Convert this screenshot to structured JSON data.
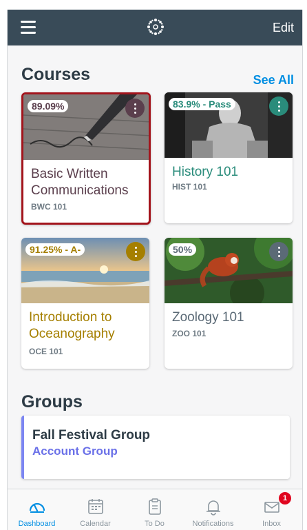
{
  "navbar": {
    "edit_label": "Edit"
  },
  "courses_section": {
    "title": "Courses",
    "see_all": "See All"
  },
  "courses": [
    {
      "grade": "89.09%",
      "name": "Basic Written Communications",
      "code": "BWC 101",
      "color": "#5b3f4d"
    },
    {
      "grade": "83.9% - Pass",
      "name": "History 101",
      "code": "HIST 101",
      "color": "#2a8c7b"
    },
    {
      "grade": "91.25% - A-",
      "name": "Introduction to Oceanography",
      "code": "OCE 101",
      "color": "#a57f00"
    },
    {
      "grade": "50%",
      "name": "Zoology 101",
      "code": "ZOO 101",
      "color": "#5b6a76"
    }
  ],
  "groups_section": {
    "title": "Groups"
  },
  "group": {
    "name": "Fall Festival Group",
    "subtitle": "Account Group",
    "color": "#7c86f2"
  },
  "tabbar": {
    "tabs": [
      {
        "label": "Dashboard",
        "icon": "dashboard-icon"
      },
      {
        "label": "Calendar",
        "icon": "calendar-icon"
      },
      {
        "label": "To Do",
        "icon": "todo-icon"
      },
      {
        "label": "Notifications",
        "icon": "bell-icon"
      },
      {
        "label": "Inbox",
        "icon": "envelope-icon"
      }
    ],
    "inbox_badge": "1"
  }
}
